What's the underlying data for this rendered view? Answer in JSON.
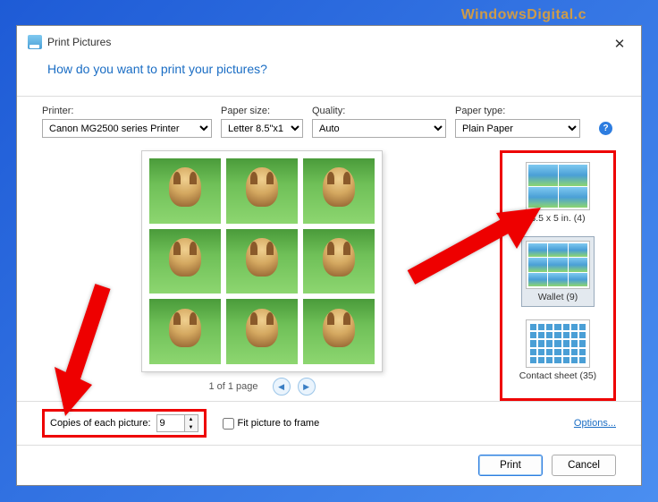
{
  "watermark": "WindowsDigital.c",
  "dialog": {
    "title": "Print Pictures",
    "question": "How do you want to print your pictures?"
  },
  "controls": {
    "printer": {
      "label": "Printer:",
      "value": "Canon MG2500 series Printer"
    },
    "paper_size": {
      "label": "Paper size:",
      "value": "Letter 8.5\"x1"
    },
    "quality": {
      "label": "Quality:",
      "value": "Auto"
    },
    "paper_type": {
      "label": "Paper type:",
      "value": "Plain Paper"
    }
  },
  "pager": {
    "text": "1 of 1 page"
  },
  "layouts": [
    {
      "label": "3.5 x 5 in. (4)",
      "grid": "g2x2",
      "selected": false
    },
    {
      "label": "Wallet (9)",
      "grid": "g3x3",
      "selected": true
    },
    {
      "label": "Contact sheet (35)",
      "grid": "g7x5",
      "selected": false
    }
  ],
  "copies": {
    "label": "Copies of each picture:",
    "value": "9"
  },
  "fit": {
    "label": "Fit picture to frame",
    "checked": false
  },
  "options_link": "Options...",
  "buttons": {
    "print": "Print",
    "cancel": "Cancel"
  }
}
